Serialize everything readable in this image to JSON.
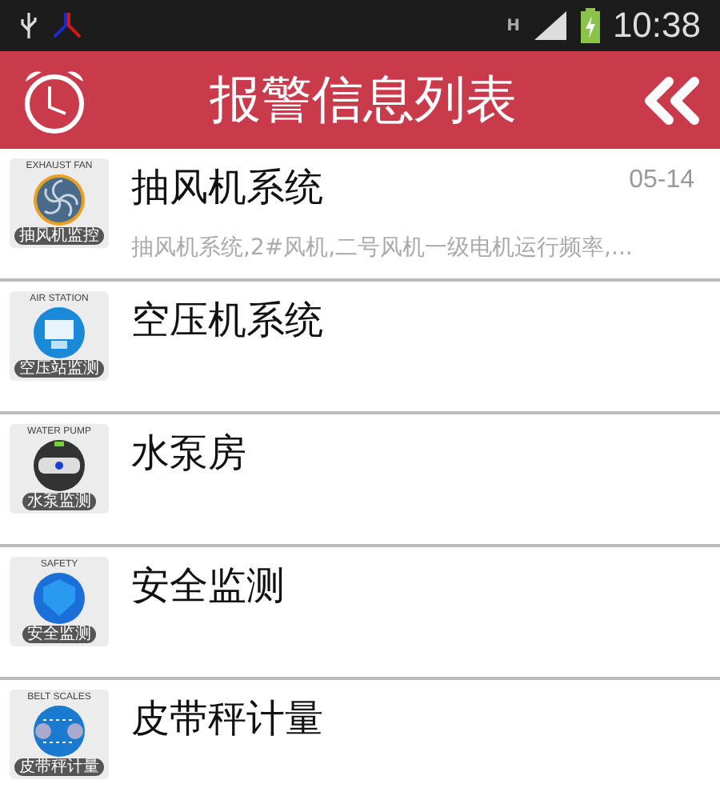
{
  "status_bar": {
    "network": "H",
    "time": "10:38"
  },
  "header": {
    "title": "报警信息列表"
  },
  "alarms": [
    {
      "kind": "fan",
      "tile_caption": "EXHAUST FAN",
      "tile_label": "抽风机监控",
      "title": "抽风机系统",
      "date": "05-14",
      "summary": "抽风机系统,2#风机,二号风机一级电机运行频率,..."
    },
    {
      "kind": "air",
      "tile_caption": "AIR  STATION",
      "tile_label": "空压站监测",
      "title": "空压机系统"
    },
    {
      "kind": "pump",
      "tile_caption": "WATER  PUMP",
      "tile_label": "水泵监测",
      "title": "水泵房"
    },
    {
      "kind": "safety",
      "tile_caption": "SAFETY",
      "tile_label": "安全监测",
      "title": "安全监测"
    },
    {
      "kind": "belt",
      "tile_caption": "BELT SCALES",
      "tile_label": "皮带秤计量",
      "title": "皮带秤计量"
    }
  ]
}
